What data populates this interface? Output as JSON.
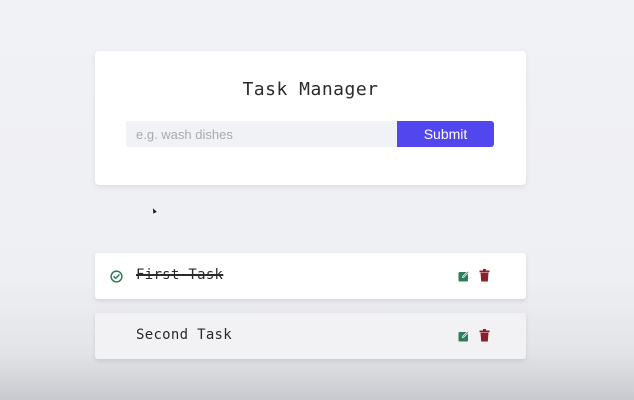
{
  "app": {
    "title": "Task Manager"
  },
  "form": {
    "placeholder": "e.g. wash dishes",
    "value": "",
    "submit_label": "Submit"
  },
  "tasks": [
    {
      "label": "First Task",
      "completed": true
    },
    {
      "label": "Second Task",
      "completed": false
    }
  ],
  "colors": {
    "accent": "#5246ef",
    "check": "#2e7d5b",
    "edit": "#2e7d5b",
    "delete": "#8b1e2b"
  },
  "icons": {
    "check": "check-circle-icon",
    "edit": "edit-icon",
    "delete": "trash-icon"
  }
}
